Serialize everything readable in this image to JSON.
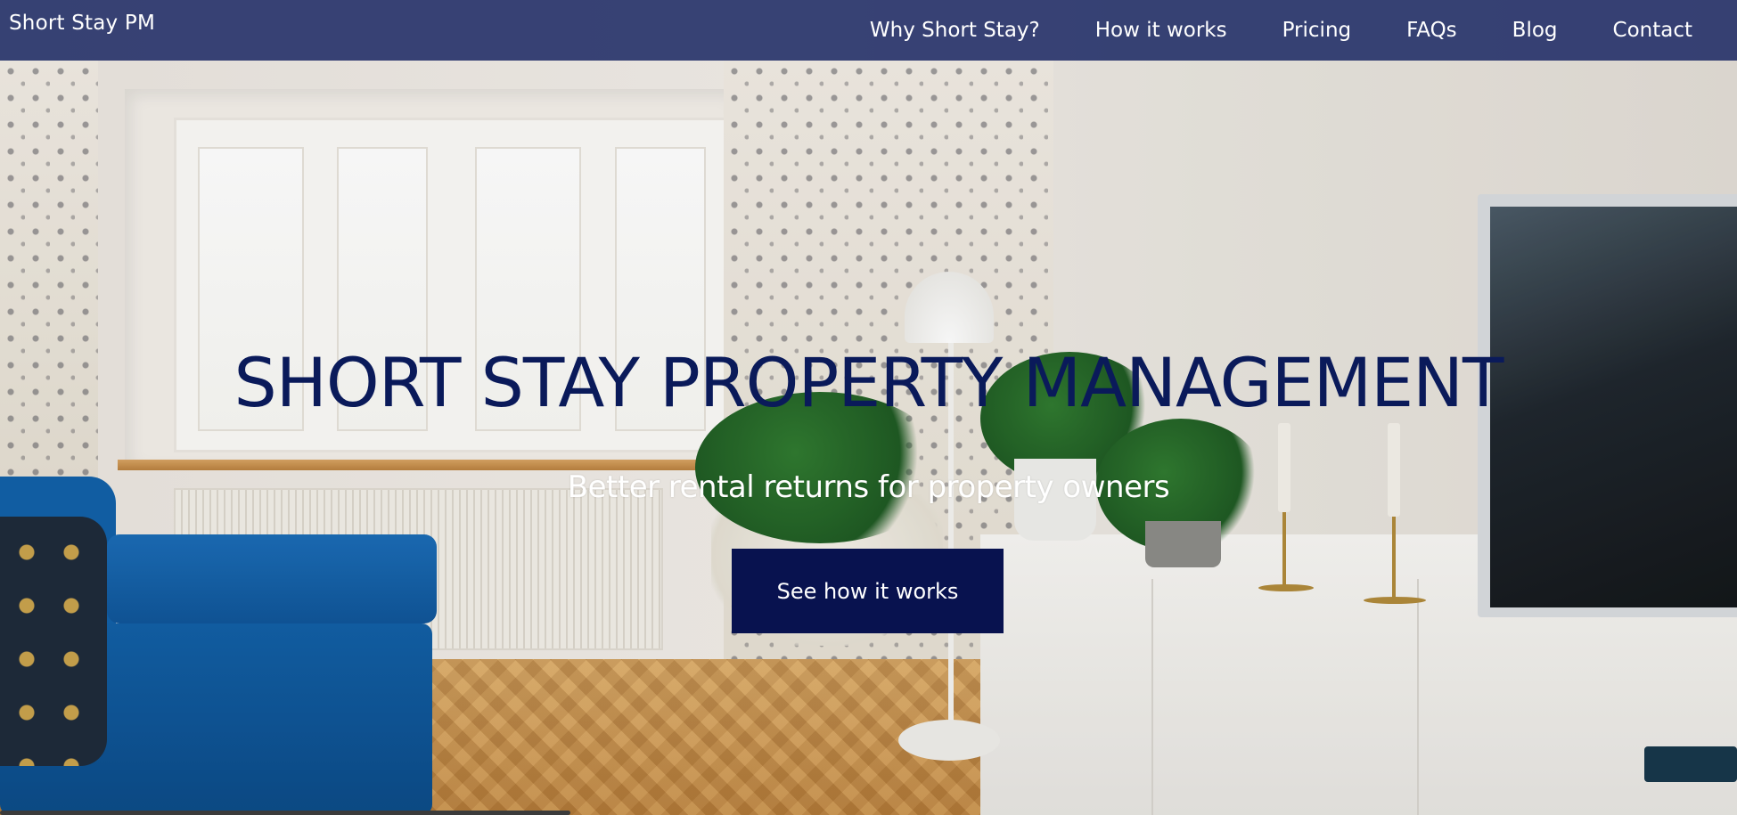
{
  "nav": {
    "brand": "Short Stay PM",
    "links": [
      {
        "label": "Why Short Stay?"
      },
      {
        "label": "How it works"
      },
      {
        "label": "Pricing"
      },
      {
        "label": "FAQs"
      },
      {
        "label": "Blog"
      },
      {
        "label": "Contact"
      }
    ]
  },
  "hero": {
    "title": "SHORT STAY PROPERTY MANAGEMENT",
    "subtitle": "Better rental returns for property owners",
    "cta_label": "See how it works",
    "background_image": "living-room-photo"
  },
  "colors": {
    "nav_background": "#243068",
    "title_color": "#0a1a5a",
    "button_background": "#08124f",
    "text_light": "#ffffff"
  }
}
